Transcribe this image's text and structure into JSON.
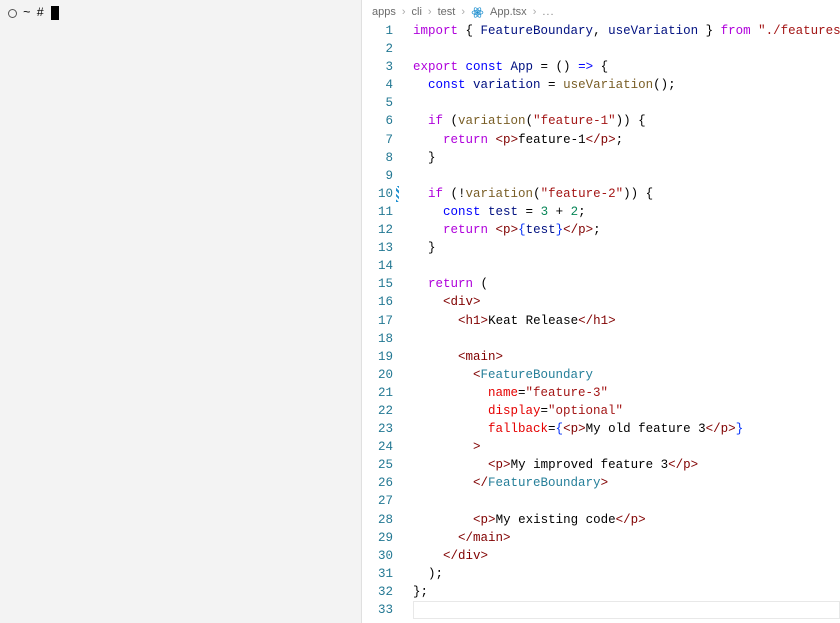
{
  "terminal": {
    "tilde": "~",
    "hash": "#"
  },
  "breadcrumbs": {
    "segments": [
      "apps",
      "cli",
      "test",
      "App.tsx"
    ],
    "file_icon": "react",
    "trailing": "..."
  },
  "editor": {
    "filename": "App.tsx",
    "gutter_modified_lines": [
      10
    ],
    "cursor_line": 33,
    "lines": [
      {
        "n": 1,
        "tokens": [
          [
            "import ",
            "keyword2"
          ],
          [
            "{ ",
            "punct"
          ],
          [
            "FeatureBoundary",
            "var"
          ],
          [
            ", ",
            "punct"
          ],
          [
            "useVariation",
            "var"
          ],
          [
            " }",
            "punct"
          ],
          [
            " from ",
            "keyword2"
          ],
          [
            "\"./features\"",
            "str"
          ],
          [
            ";",
            "punct"
          ]
        ]
      },
      {
        "n": 2,
        "tokens": []
      },
      {
        "n": 3,
        "tokens": [
          [
            "export ",
            "keyword2"
          ],
          [
            "const ",
            "key"
          ],
          [
            "App",
            "var"
          ],
          [
            " = () ",
            "punct"
          ],
          [
            "=>",
            "key"
          ],
          [
            " {",
            "punct"
          ]
        ]
      },
      {
        "n": 4,
        "tokens": [
          [
            "  ",
            "text"
          ],
          [
            "const ",
            "key"
          ],
          [
            "variation",
            "var"
          ],
          [
            " = ",
            "punct"
          ],
          [
            "useVariation",
            "func"
          ],
          [
            "();",
            "punct"
          ]
        ]
      },
      {
        "n": 5,
        "tokens": []
      },
      {
        "n": 6,
        "tokens": [
          [
            "  ",
            "text"
          ],
          [
            "if ",
            "keyword2"
          ],
          [
            "(",
            "punct"
          ],
          [
            "variation",
            "func"
          ],
          [
            "(",
            "punct"
          ],
          [
            "\"feature-1\"",
            "str"
          ],
          [
            ")) {",
            "punct"
          ]
        ]
      },
      {
        "n": 7,
        "tokens": [
          [
            "    ",
            "text"
          ],
          [
            "return ",
            "keyword2"
          ],
          [
            "<",
            "tag"
          ],
          [
            "p",
            "tag"
          ],
          [
            ">",
            "tag"
          ],
          [
            "feature-1",
            "text"
          ],
          [
            "</",
            "tag"
          ],
          [
            "p",
            "tag"
          ],
          [
            ">",
            "tag"
          ],
          [
            ";",
            "punct"
          ]
        ]
      },
      {
        "n": 8,
        "tokens": [
          [
            "  }",
            "punct"
          ]
        ]
      },
      {
        "n": 9,
        "tokens": []
      },
      {
        "n": 10,
        "tokens": [
          [
            "  ",
            "text"
          ],
          [
            "if ",
            "keyword2"
          ],
          [
            "(!",
            "punct"
          ],
          [
            "variation",
            "func"
          ],
          [
            "(",
            "punct"
          ],
          [
            "\"feature-2\"",
            "str"
          ],
          [
            ")) {",
            "punct"
          ]
        ]
      },
      {
        "n": 11,
        "tokens": [
          [
            "    ",
            "text"
          ],
          [
            "const ",
            "key"
          ],
          [
            "test",
            "var"
          ],
          [
            " = ",
            "punct"
          ],
          [
            "3",
            "num"
          ],
          [
            " + ",
            "punct"
          ],
          [
            "2",
            "num"
          ],
          [
            ";",
            "punct"
          ]
        ]
      },
      {
        "n": 12,
        "tokens": [
          [
            "    ",
            "text"
          ],
          [
            "return ",
            "keyword2"
          ],
          [
            "<",
            "tag"
          ],
          [
            "p",
            "tag"
          ],
          [
            ">",
            "tag"
          ],
          [
            "{",
            "brace"
          ],
          [
            "test",
            "var"
          ],
          [
            "}",
            "brace"
          ],
          [
            "</",
            "tag"
          ],
          [
            "p",
            "tag"
          ],
          [
            ">",
            "tag"
          ],
          [
            ";",
            "punct"
          ]
        ]
      },
      {
        "n": 13,
        "tokens": [
          [
            "  }",
            "punct"
          ]
        ]
      },
      {
        "n": 14,
        "tokens": []
      },
      {
        "n": 15,
        "tokens": [
          [
            "  ",
            "text"
          ],
          [
            "return ",
            "keyword2"
          ],
          [
            "(",
            "punct"
          ]
        ]
      },
      {
        "n": 16,
        "tokens": [
          [
            "    ",
            "text"
          ],
          [
            "<",
            "tag"
          ],
          [
            "div",
            "tag"
          ],
          [
            ">",
            "tag"
          ]
        ]
      },
      {
        "n": 17,
        "tokens": [
          [
            "      ",
            "text"
          ],
          [
            "<",
            "tag"
          ],
          [
            "h1",
            "tag"
          ],
          [
            ">",
            "tag"
          ],
          [
            "Keat Release",
            "text"
          ],
          [
            "</",
            "tag"
          ],
          [
            "h1",
            "tag"
          ],
          [
            ">",
            "tag"
          ]
        ]
      },
      {
        "n": 18,
        "tokens": []
      },
      {
        "n": 19,
        "tokens": [
          [
            "      ",
            "text"
          ],
          [
            "<",
            "tag"
          ],
          [
            "main",
            "tag"
          ],
          [
            ">",
            "tag"
          ]
        ]
      },
      {
        "n": 20,
        "tokens": [
          [
            "        ",
            "text"
          ],
          [
            "<",
            "tag"
          ],
          [
            "FeatureBoundary",
            "tag-comp"
          ]
        ]
      },
      {
        "n": 21,
        "tokens": [
          [
            "          ",
            "text"
          ],
          [
            "name",
            "attr"
          ],
          [
            "=",
            "punct"
          ],
          [
            "\"feature-3\"",
            "str"
          ]
        ]
      },
      {
        "n": 22,
        "tokens": [
          [
            "          ",
            "text"
          ],
          [
            "display",
            "attr"
          ],
          [
            "=",
            "punct"
          ],
          [
            "\"optional\"",
            "str"
          ]
        ]
      },
      {
        "n": 23,
        "tokens": [
          [
            "          ",
            "text"
          ],
          [
            "fallback",
            "attr"
          ],
          [
            "=",
            "punct"
          ],
          [
            "{",
            "brace"
          ],
          [
            "<",
            "tag"
          ],
          [
            "p",
            "tag"
          ],
          [
            ">",
            "tag"
          ],
          [
            "My old feature 3",
            "text"
          ],
          [
            "</",
            "tag"
          ],
          [
            "p",
            "tag"
          ],
          [
            ">",
            "tag"
          ],
          [
            "}",
            "brace"
          ]
        ]
      },
      {
        "n": 24,
        "tokens": [
          [
            "        ",
            "text"
          ],
          [
            ">",
            "tag"
          ]
        ]
      },
      {
        "n": 25,
        "tokens": [
          [
            "          ",
            "text"
          ],
          [
            "<",
            "tag"
          ],
          [
            "p",
            "tag"
          ],
          [
            ">",
            "tag"
          ],
          [
            "My improved feature 3",
            "text"
          ],
          [
            "</",
            "tag"
          ],
          [
            "p",
            "tag"
          ],
          [
            ">",
            "tag"
          ]
        ]
      },
      {
        "n": 26,
        "tokens": [
          [
            "        ",
            "text"
          ],
          [
            "</",
            "tag"
          ],
          [
            "FeatureBoundary",
            "tag-comp"
          ],
          [
            ">",
            "tag"
          ]
        ]
      },
      {
        "n": 27,
        "tokens": []
      },
      {
        "n": 28,
        "tokens": [
          [
            "        ",
            "text"
          ],
          [
            "<",
            "tag"
          ],
          [
            "p",
            "tag"
          ],
          [
            ">",
            "tag"
          ],
          [
            "My existing code",
            "text"
          ],
          [
            "</",
            "tag"
          ],
          [
            "p",
            "tag"
          ],
          [
            ">",
            "tag"
          ]
        ]
      },
      {
        "n": 29,
        "tokens": [
          [
            "      ",
            "text"
          ],
          [
            "</",
            "tag"
          ],
          [
            "main",
            "tag"
          ],
          [
            ">",
            "tag"
          ]
        ]
      },
      {
        "n": 30,
        "tokens": [
          [
            "    ",
            "text"
          ],
          [
            "</",
            "tag"
          ],
          [
            "div",
            "tag"
          ],
          [
            ">",
            "tag"
          ]
        ]
      },
      {
        "n": 31,
        "tokens": [
          [
            "  );",
            "punct"
          ]
        ]
      },
      {
        "n": 32,
        "tokens": [
          [
            "};",
            "punct"
          ]
        ]
      },
      {
        "n": 33,
        "tokens": []
      }
    ]
  }
}
